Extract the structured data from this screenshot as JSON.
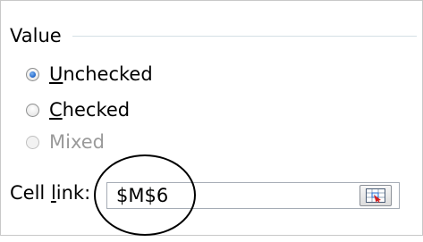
{
  "value_group": {
    "title": "Value",
    "options": [
      {
        "underlined": "U",
        "rest": "nchecked",
        "selected": true,
        "enabled": true
      },
      {
        "underlined": "C",
        "rest": "hecked",
        "selected": false,
        "enabled": true
      },
      {
        "underlined": "",
        "rest": "Mixed",
        "selected": false,
        "enabled": false
      }
    ]
  },
  "cell_link": {
    "label_pre": "Cell ",
    "label_underlined": "l",
    "label_post": "ink:",
    "value": "$M$6"
  },
  "colors": {
    "radio_selected": "#2a6fd0",
    "annotation_circle": "#000000",
    "disabled_text": "#9a9a9a"
  },
  "icons": {
    "ref_button": "collapse-dialog-icon"
  }
}
